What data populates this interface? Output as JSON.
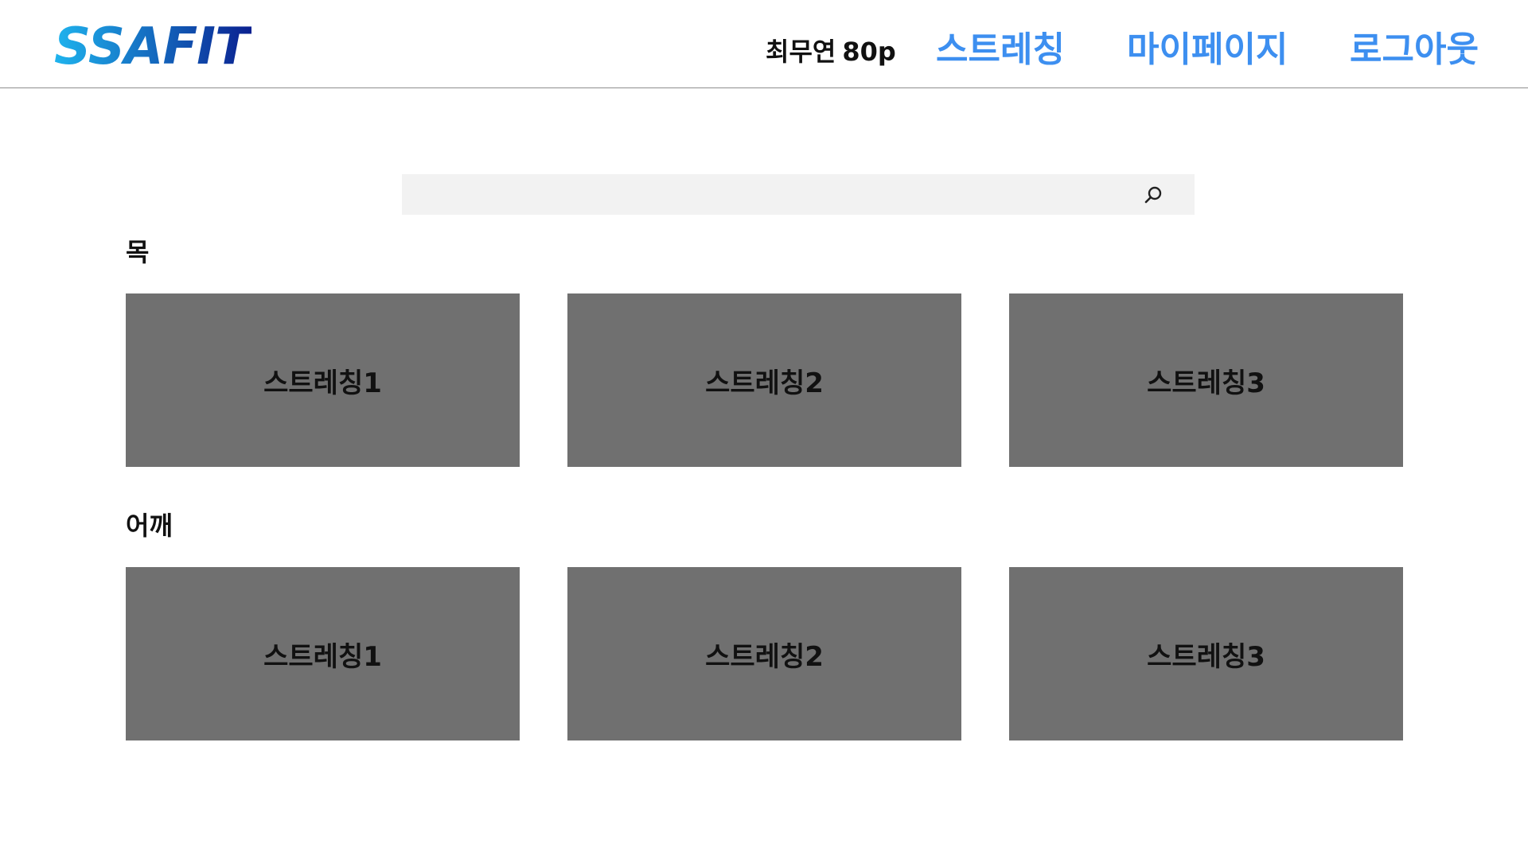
{
  "header": {
    "logo_text": "SSAFIT",
    "user_name": "최무연",
    "user_points": "80p",
    "nav": {
      "stretching": "스트레칭",
      "mypage": "마이페이지",
      "logout": "로그아웃"
    }
  },
  "search": {
    "value": "",
    "placeholder": "",
    "icon": "search-icon"
  },
  "sections": [
    {
      "title": "목",
      "cards": [
        {
          "label": "스트레칭1"
        },
        {
          "label": "스트레칭2"
        },
        {
          "label": "스트레칭3"
        }
      ]
    },
    {
      "title": "어깨",
      "cards": [
        {
          "label": "스트레칭1"
        },
        {
          "label": "스트레칭2"
        },
        {
          "label": "스트레칭3"
        }
      ]
    }
  ],
  "colors": {
    "nav_link": "#3d8ff0",
    "card_background": "#707070",
    "search_background": "#f2f2f2",
    "logo_gradient_start": "#1fb4ee",
    "logo_gradient_end": "#0a1f8f"
  }
}
